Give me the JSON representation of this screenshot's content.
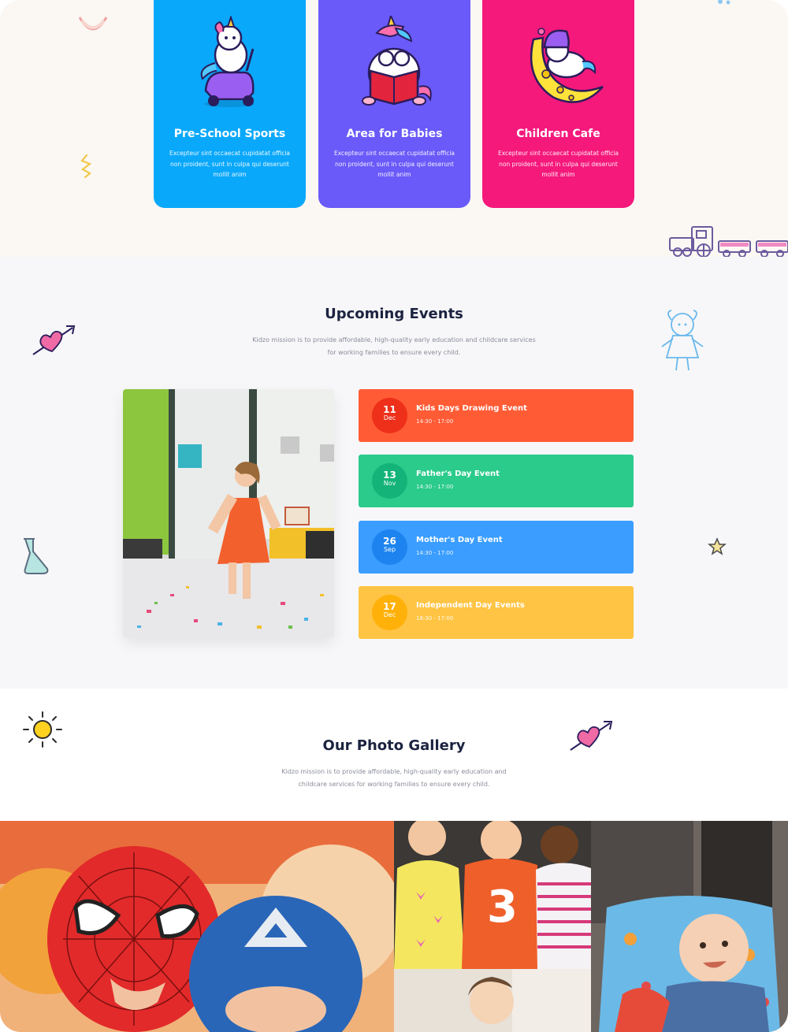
{
  "services": {
    "cards": [
      {
        "title": "Pre-School Sports",
        "description": "Excepteur sint occaecat cupidatat officia non proident, sunt in culpa qui deserunt mollit anim",
        "bg_color": "#0aa8fb",
        "icon": "unicorn-scooter-icon"
      },
      {
        "title": "Area for Babies",
        "description": "Excepteur sint occaecat cupidatat officia non proident, sunt in culpa qui deserunt mollit anim",
        "bg_color": "#6a5af9",
        "icon": "unicorn-reading-icon"
      },
      {
        "title": "Children Cafe",
        "description": "Excepteur sint occaecat cupidatat officia non proident, sunt in culpa qui deserunt mollit anim",
        "bg_color": "#f5197c",
        "icon": "unicorn-moon-icon"
      }
    ]
  },
  "events": {
    "title": "Upcoming Events",
    "description": "Kidzo mission is to provide affordable, high-quality early education and childcare services for working families to ensure every child.",
    "items": [
      {
        "day": "11",
        "month": "Dec",
        "title": "Kids Days Drawing Event",
        "time": "14:30 - 17:00",
        "color": "#ff5b35",
        "badge_color": "#ee2f1a"
      },
      {
        "day": "13",
        "month": "Nov",
        "title": "Father's Day Event",
        "time": "14:30 - 17:00",
        "color": "#2bcb8b",
        "badge_color": "#13b379"
      },
      {
        "day": "26",
        "month": "Sep",
        "title": "Mother's Day Event",
        "time": "14:30 - 17:00",
        "color": "#3a9dff",
        "badge_color": "#1d84ef"
      },
      {
        "day": "17",
        "month": "Dec",
        "title": "Independent Day Events",
        "time": "18:30 - 17:00",
        "color": "#ffc444",
        "badge_color": "#ffb10a"
      }
    ]
  },
  "gallery": {
    "title": "Our Photo Gallery",
    "description": "Kidzo mission is to provide affordable, high-quality early education and childcare services for working families to ensure every child."
  },
  "colors": {
    "heading": "#1c2340",
    "muted_text": "#8a8d99",
    "section_cream": "#fbf8f4",
    "section_grey": "#f7f7f9"
  }
}
